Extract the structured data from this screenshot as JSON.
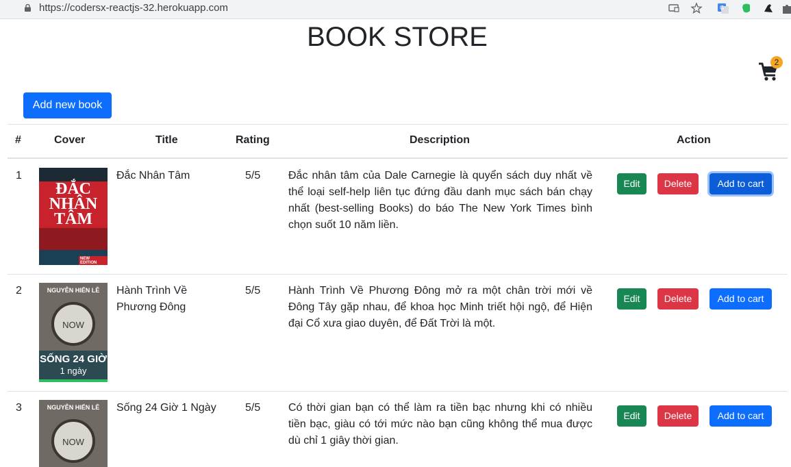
{
  "browser": {
    "url": "https://codersx-reactjs-32.herokuapp.com"
  },
  "header": {
    "title": "BOOK STORE",
    "cart_count": "2"
  },
  "toolbar": {
    "add_book_label": "Add new book"
  },
  "table": {
    "columns": [
      "#",
      "Cover",
      "Title",
      "Rating",
      "Description",
      "Action"
    ],
    "rows": [
      {
        "index": "1",
        "title": "Đắc Nhân Tâm",
        "rating": "5/5",
        "description": "Đắc nhân tâm của Dale Carnegie là quyển sách duy nhất về thể loại self-help liên tục đứng đầu danh mục sách bán chạy nhất (best-selling Books) do báo The New York Times bình chọn suốt 10 năm liền.",
        "cover_lines": [
          "ĐẮC",
          "NHÂN",
          "TÂM"
        ],
        "cover_badge": "NEW EDITION"
      },
      {
        "index": "2",
        "title": "Hành Trình Về Phương Đông",
        "rating": "5/5",
        "description": "Hành Trình Về Phương Đông mở ra một chân trời mới về Đông Tây gặp nhau, để khoa học Minh triết hội ngộ, để Hiện đại Cổ xưa giao duyên, để Đất Trời là một.",
        "cover_author": "NGUYỄN HIẾN LÊ",
        "cover_clock": "NOW",
        "cover_bottom_1": "SỐNG 24 GIỜ",
        "cover_bottom_2": "1 ngày"
      },
      {
        "index": "3",
        "title": "Sống 24 Giờ 1 Ngày",
        "rating": "5/5",
        "description": "Có thời gian bạn có thể làm ra tiền bạc nhưng khi có nhiều tiền bạc, giàu có tới mức nào bạn cũng không thể mua được dù chỉ 1 giây thời gian.",
        "cover_author": "NGUYỄN HIẾN LÊ",
        "cover_clock": "NOW"
      }
    ],
    "actions": {
      "edit": "Edit",
      "delete": "Delete",
      "add_to_cart": "Add to cart"
    }
  },
  "colors": {
    "primary": "#0d6efd",
    "success": "#198754",
    "danger": "#dc3545",
    "badge": "#f5a623"
  }
}
